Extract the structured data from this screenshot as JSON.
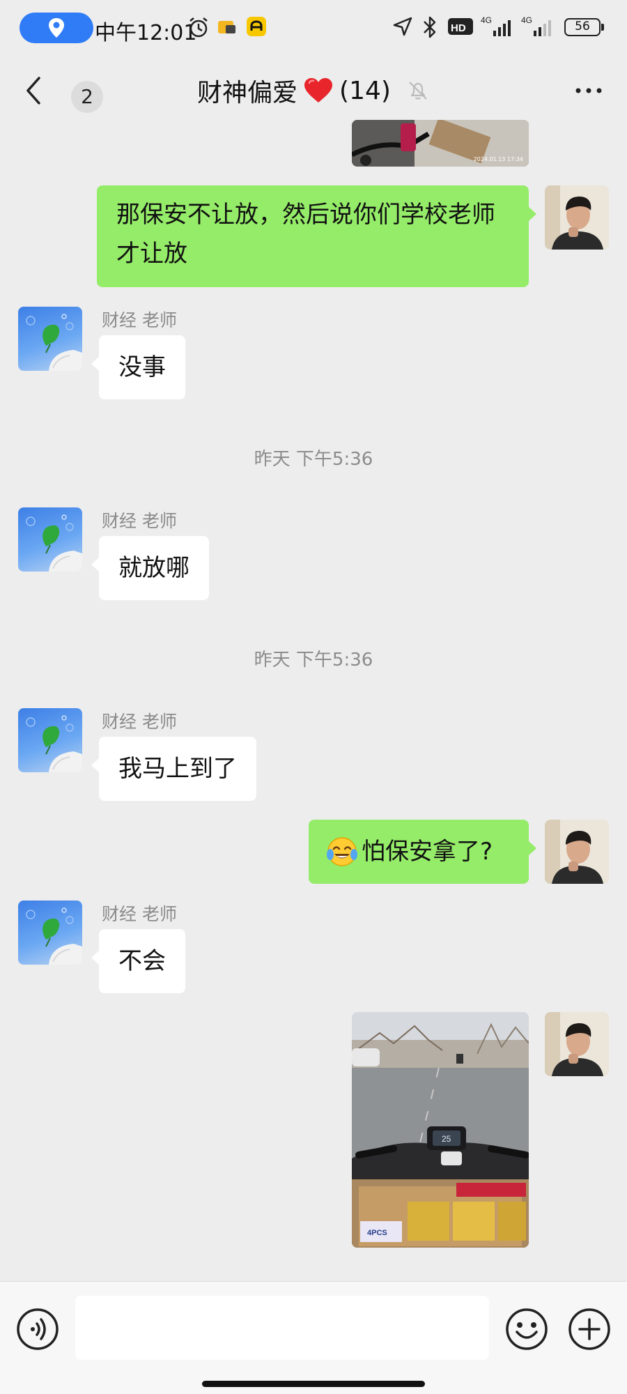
{
  "status_bar": {
    "time": "中午12:01",
    "battery": "56",
    "net1": "4G",
    "net2": "4G",
    "hd": "HD"
  },
  "header": {
    "back_count": "2",
    "title": "财神偏爱",
    "member_count": "(14)",
    "heart_color": "#e8252b"
  },
  "messages": {
    "m1_out": "那保安不让放，然后说你们学校老师才让放",
    "m2_sender": "财经 老师",
    "m2_text": "没事",
    "ts1": "昨天 下午5:36",
    "m3_sender": "财经 老师",
    "m3_text": "就放哪",
    "ts2": "昨天 下午5:36",
    "m4_sender": "财经 老师",
    "m4_text": "我马上到了",
    "m5_out": "怕保安拿了?",
    "m6_sender": "财经 老师",
    "m6_text": "不会",
    "photo_top_stamp": "2024.01.13 17:34",
    "photo_speed": "25",
    "photo_box_label": "4PCS"
  },
  "input": {
    "placeholder": ""
  },
  "colors": {
    "out_bubble": "#95ec69",
    "in_bubble": "#ffffff",
    "background": "#ededed"
  }
}
